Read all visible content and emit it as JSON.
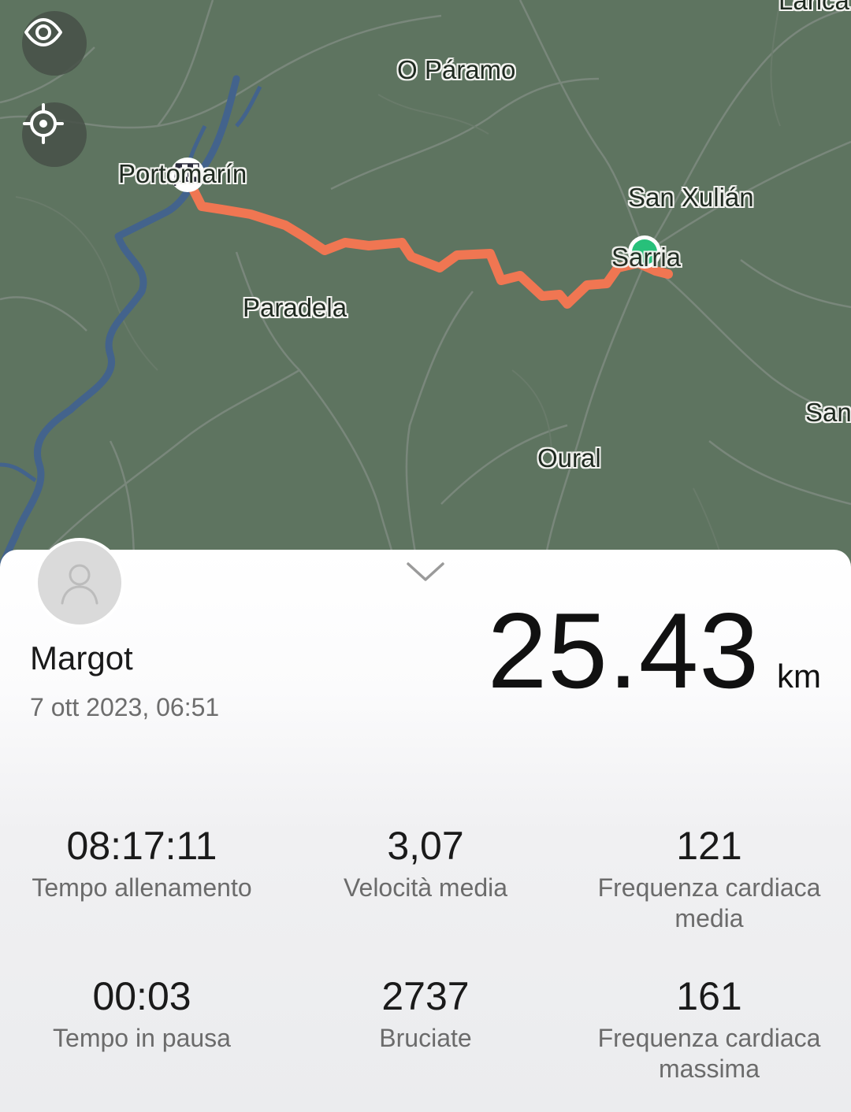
{
  "map": {
    "labels": {
      "o_paramo": "O Páramo",
      "portomarin": "Portomarín",
      "san_xulian": "San Xulián",
      "sarria": "Sarria",
      "paradela": "Paradela",
      "oural": "Oural",
      "lanca": "Lanca",
      "san": "San"
    },
    "route_color": "#f07652",
    "start_marker_color": "#27c07a",
    "water_color": "#43638c"
  },
  "buttons": {
    "visibility_icon": "eye-icon",
    "locate_icon": "crosshair-icon"
  },
  "summary": {
    "avatar_icon": "person-icon",
    "collapse_icon": "chevron-down-icon",
    "name": "Margot",
    "date": "7 ott 2023, 06:51",
    "distance": "25.43",
    "distance_unit": "km"
  },
  "stats": [
    {
      "value": "08:17:11",
      "label": "Tempo allenamento"
    },
    {
      "value": "3,07",
      "label": "Velocità media"
    },
    {
      "value": "121",
      "label": "Frequenza cardiaca media"
    },
    {
      "value": "00:03",
      "label": "Tempo in pausa"
    },
    {
      "value": "2737",
      "label": "Bruciate"
    },
    {
      "value": "161",
      "label": "Frequenza cardiaca massima"
    }
  ]
}
